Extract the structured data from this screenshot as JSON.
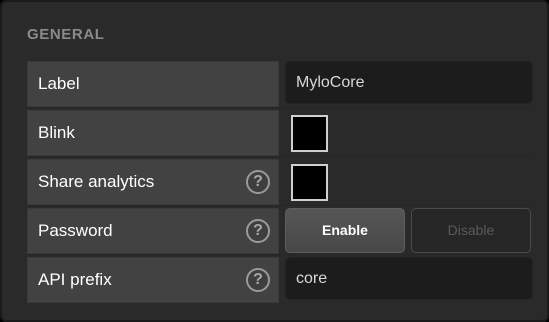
{
  "section": {
    "title": "GENERAL"
  },
  "rows": {
    "label": {
      "label": "Label",
      "value": "MyloCore"
    },
    "blink": {
      "label": "Blink",
      "checked": false
    },
    "share_analytics": {
      "label": "Share analytics",
      "help": "?",
      "checked": false
    },
    "password": {
      "label": "Password",
      "help": "?",
      "enable_label": "Enable",
      "disable_label": "Disable"
    },
    "api_prefix": {
      "label": "API prefix",
      "help": "?",
      "value": "core"
    }
  },
  "colors": {
    "panel_bg": "#2a2a2a",
    "label_cell_bg": "#424242",
    "input_bg": "#1c1c1c",
    "checkbox_fill": "#000000",
    "checkbox_border": "#cfcfcf"
  }
}
